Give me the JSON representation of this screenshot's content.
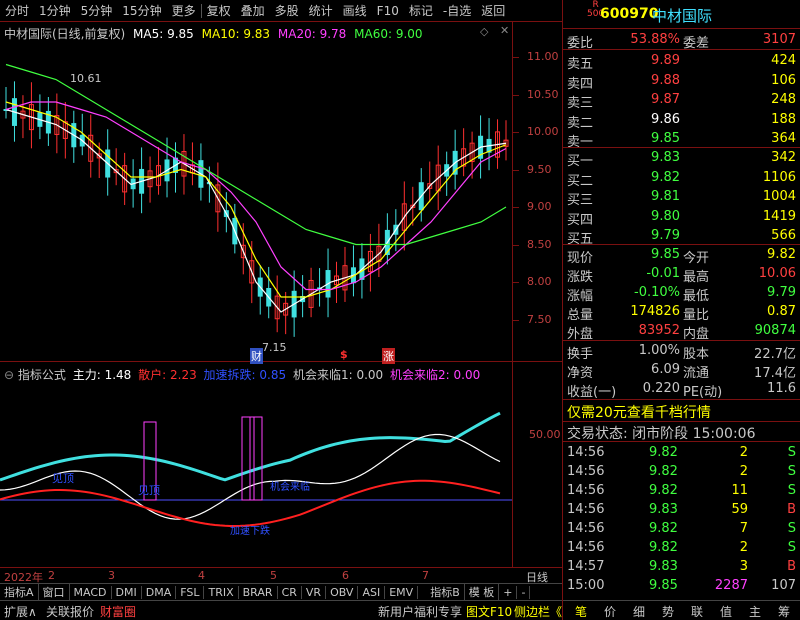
{
  "toolbar": {
    "items": [
      "分时",
      "1分钟",
      "5分钟",
      "15分钟",
      "更多",
      "复权",
      "叠加",
      "多股",
      "统计",
      "画线",
      "F10",
      "标记",
      "-自选",
      "返回"
    ]
  },
  "chart_header": {
    "title": "中材国际(日线,前复权)",
    "ma5": "MA5: 9.85",
    "ma10": "MA10: 9.83",
    "ma20": "MA20: 9.78",
    "ma60": "MA60: 9.00"
  },
  "price_axis": [
    "11.00",
    "10.50",
    "10.00",
    "9.50",
    "9.00",
    "8.50",
    "8.00",
    "7.50"
  ],
  "annotations": {
    "high": "10.61",
    "low": "7.15",
    "cai": "财",
    "dollar": "$",
    "zhang": "涨"
  },
  "indicator_header": {
    "title": "指标公式",
    "main": "主力: 1.48",
    "retail": "散户: 2.23",
    "accel": "加速拆跌: 0.85",
    "chance1": "机会来临1: 0.00",
    "chance2": "机会来临2: 0.00"
  },
  "indicator_axis": {
    "level": "50.00"
  },
  "indicator_labels": [
    "见顶",
    "见顶",
    "加速下跌",
    "机会来临"
  ],
  "x_axis": [
    "2022年",
    "2",
    "3",
    "4",
    "5",
    "6",
    "7"
  ],
  "x_axis_right": "日线",
  "tabs": [
    "指标A",
    "窗口",
    "MACD",
    "DMI",
    "DMA",
    "FSL",
    "TRIX",
    "BRAR",
    "CR",
    "VR",
    "OBV",
    "ASI",
    "EMV",
    "指标B",
    "模 板",
    "+",
    "-"
  ],
  "bottom": {
    "items": [
      "扩展∧",
      "关联报价",
      "财富圈"
    ],
    "promo": "新用户福利专享",
    "f10": "图文F10",
    "side": "侧边栏《"
  },
  "right_tabs": [
    "笔",
    "价",
    "细",
    "势",
    "联",
    "值",
    "主",
    "筹"
  ],
  "quote": {
    "rmark": "R",
    "rnum": "500",
    "code": "600970",
    "name": "中材国际",
    "webi_label": "委比",
    "webi": "53.88%",
    "weicha_label": "委差",
    "weicha": "3107",
    "sells": [
      {
        "label": "卖五",
        "price": "9.89",
        "vol": "424"
      },
      {
        "label": "卖四",
        "price": "9.88",
        "vol": "106"
      },
      {
        "label": "卖三",
        "price": "9.87",
        "vol": "248"
      },
      {
        "label": "卖二",
        "price": "9.86",
        "vol": "188"
      },
      {
        "label": "卖一",
        "price": "9.85",
        "vol": "364"
      }
    ],
    "buys": [
      {
        "label": "买一",
        "price": "9.83",
        "vol": "342"
      },
      {
        "label": "买二",
        "price": "9.82",
        "vol": "1106"
      },
      {
        "label": "买三",
        "price": "9.81",
        "vol": "1004"
      },
      {
        "label": "买四",
        "price": "9.80",
        "vol": "1419"
      },
      {
        "label": "买五",
        "price": "9.79",
        "vol": "566"
      }
    ],
    "stats": [
      {
        "l1": "现价",
        "v1": "9.85",
        "l2": "今开",
        "v2": "9.82"
      },
      {
        "l1": "涨跌",
        "v1": "-0.01",
        "l2": "最高",
        "v2": "10.06"
      },
      {
        "l1": "涨幅",
        "v1": "-0.10%",
        "l2": "最低",
        "v2": "9.79"
      },
      {
        "l1": "总量",
        "v1": "174826",
        "l2": "量比",
        "v2": "0.87"
      },
      {
        "l1": "外盘",
        "v1": "83952",
        "l2": "内盘",
        "v2": "90874"
      }
    ],
    "stats2": [
      {
        "l1": "换手",
        "v1": "1.00%",
        "l2": "股本",
        "v2": "22.7亿"
      },
      {
        "l1": "净资",
        "v1": "6.09",
        "l2": "流通",
        "v2": "17.4亿"
      },
      {
        "l1": "收益(一)",
        "v1": "0.220",
        "l2": "PE(动)",
        "v2": "11.6"
      }
    ],
    "promo": "仅需20元查看千档行情",
    "trade_status": "交易状态: 闭市阶段 15:00:06",
    "ticks": [
      {
        "t": "14:56",
        "p": "9.82",
        "v": "2",
        "d": "S"
      },
      {
        "t": "14:56",
        "p": "9.82",
        "v": "2",
        "d": "S"
      },
      {
        "t": "14:56",
        "p": "9.82",
        "v": "11",
        "d": "S"
      },
      {
        "t": "14:56",
        "p": "9.83",
        "v": "59",
        "d": "B"
      },
      {
        "t": "14:56",
        "p": "9.82",
        "v": "7",
        "d": "S"
      },
      {
        "t": "14:56",
        "p": "9.82",
        "v": "2",
        "d": "S"
      },
      {
        "t": "14:57",
        "p": "9.83",
        "v": "3",
        "d": "B"
      },
      {
        "t": "15:00",
        "p": "9.85",
        "v": "2287",
        "d": "107"
      }
    ]
  },
  "chart_data": {
    "type": "line",
    "title": "中材国际(日线,前复权)",
    "series": [
      {
        "name": "MA5",
        "values": [
          10.3,
          10.2,
          10.1,
          9.9,
          9.6,
          9.3,
          9.4,
          9.6,
          9.4,
          8.8,
          8.0,
          7.6,
          7.8,
          8.0,
          8.1,
          8.4,
          8.9,
          9.3,
          9.6,
          9.8,
          9.85
        ]
      },
      {
        "name": "MA10",
        "values": [
          10.4,
          10.3,
          10.2,
          10.0,
          9.7,
          9.4,
          9.4,
          9.5,
          9.4,
          9.0,
          8.3,
          7.8,
          7.8,
          7.9,
          8.1,
          8.3,
          8.7,
          9.1,
          9.5,
          9.7,
          9.83
        ]
      },
      {
        "name": "MA20",
        "values": [
          10.3,
          10.4,
          10.4,
          10.3,
          10.2,
          10.0,
          9.8,
          9.6,
          9.5,
          9.2,
          8.8,
          8.2,
          7.9,
          7.9,
          8.0,
          8.2,
          8.5,
          8.8,
          9.2,
          9.6,
          9.78
        ]
      },
      {
        "name": "MA60",
        "values": [
          10.9,
          10.8,
          10.7,
          10.5,
          10.3,
          10.1,
          9.9,
          9.7,
          9.5,
          9.3,
          9.1,
          8.9,
          8.7,
          8.6,
          8.5,
          8.5,
          8.5,
          8.6,
          8.7,
          8.8,
          9.0
        ]
      }
    ],
    "ylim": [
      7.2,
      11.2
    ]
  }
}
